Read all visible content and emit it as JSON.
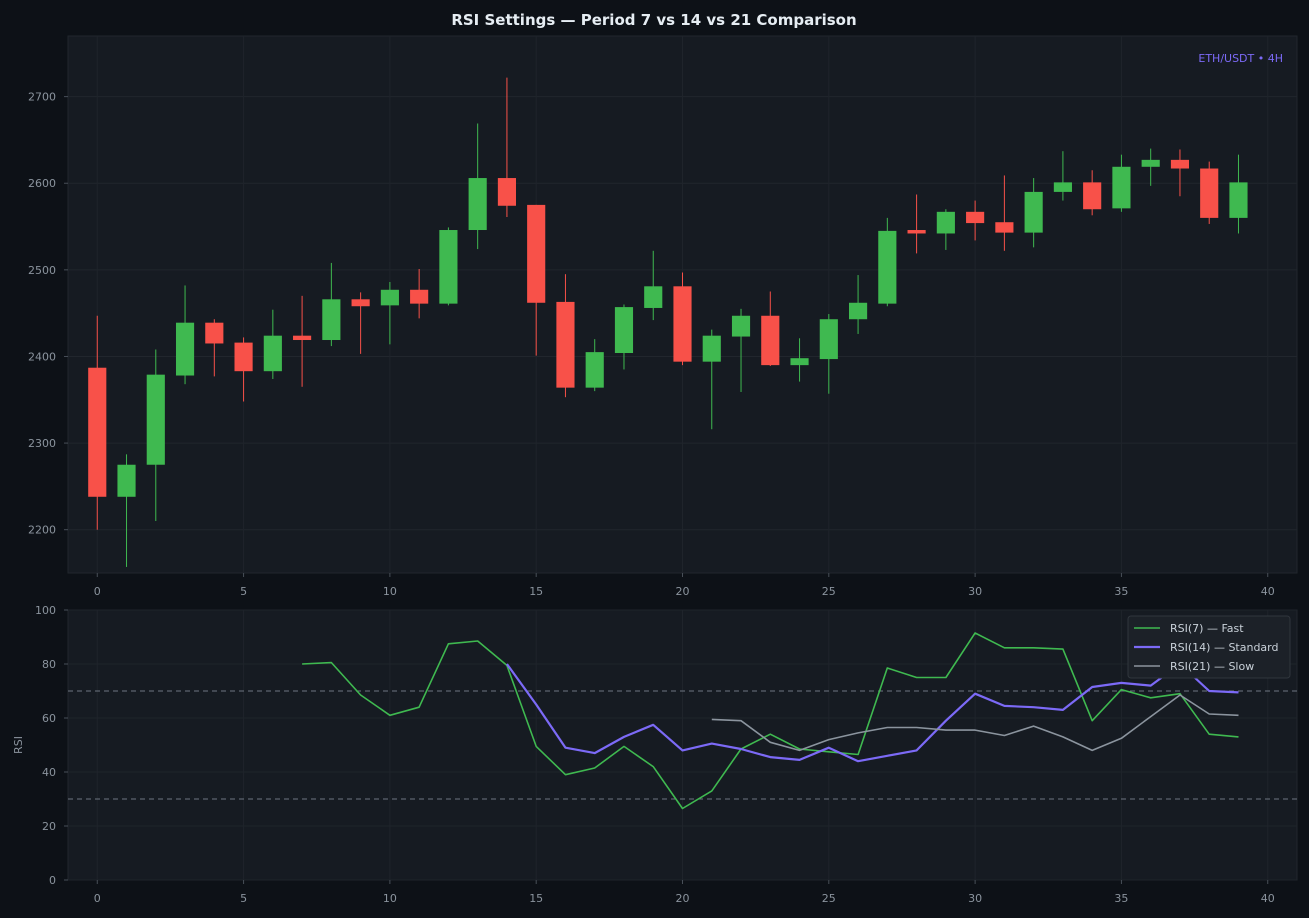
{
  "title": "RSI Settings — Period 7 vs 14 vs 21 Comparison",
  "colors": {
    "background": "#0d1117",
    "panel": "#161b22",
    "up": "#3fb950",
    "down": "#f85149",
    "rsi7": "#3fb950",
    "rsi14": "#7c6af7",
    "rsi21": "#8b949e",
    "tick_text": "#8b949e",
    "title_text": "#e6edf3",
    "watermark": "#7c6af7"
  },
  "chart_data": [
    {
      "type": "candlestick",
      "annotation": "ETH/USDT • 4H",
      "xlim": [
        -1,
        41
      ],
      "ylim": [
        2150,
        2770
      ],
      "xticks": [
        0,
        5,
        10,
        15,
        20,
        25,
        30,
        35,
        40
      ],
      "yticks": [
        2200,
        2300,
        2400,
        2500,
        2600,
        2700
      ],
      "grid": true,
      "candles": [
        {
          "x": 0,
          "o": 2387,
          "h": 2447,
          "l": 2200,
          "c": 2238
        },
        {
          "x": 1,
          "o": 2238,
          "h": 2287,
          "l": 2157,
          "c": 2275
        },
        {
          "x": 2,
          "o": 2275,
          "h": 2408,
          "l": 2210,
          "c": 2379
        },
        {
          "x": 3,
          "o": 2378,
          "h": 2482,
          "l": 2368,
          "c": 2439
        },
        {
          "x": 4,
          "o": 2439,
          "h": 2443,
          "l": 2377,
          "c": 2415
        },
        {
          "x": 5,
          "o": 2416,
          "h": 2422,
          "l": 2348,
          "c": 2383
        },
        {
          "x": 6,
          "o": 2383,
          "h": 2454,
          "l": 2374,
          "c": 2424
        },
        {
          "x": 7,
          "o": 2424,
          "h": 2470,
          "l": 2365,
          "c": 2419
        },
        {
          "x": 8,
          "o": 2419,
          "h": 2508,
          "l": 2412,
          "c": 2466
        },
        {
          "x": 9,
          "o": 2466,
          "h": 2474,
          "l": 2403,
          "c": 2458
        },
        {
          "x": 10,
          "o": 2459,
          "h": 2486,
          "l": 2414,
          "c": 2477
        },
        {
          "x": 11,
          "o": 2477,
          "h": 2501,
          "l": 2444,
          "c": 2461
        },
        {
          "x": 12,
          "o": 2461,
          "h": 2549,
          "l": 2459,
          "c": 2546
        },
        {
          "x": 13,
          "o": 2546,
          "h": 2669,
          "l": 2524,
          "c": 2606
        },
        {
          "x": 14,
          "o": 2606,
          "h": 2722,
          "l": 2561,
          "c": 2574
        },
        {
          "x": 15,
          "o": 2575,
          "h": 2575,
          "l": 2401,
          "c": 2462
        },
        {
          "x": 16,
          "o": 2463,
          "h": 2495,
          "l": 2353,
          "c": 2364
        },
        {
          "x": 17,
          "o": 2364,
          "h": 2420,
          "l": 2360,
          "c": 2405
        },
        {
          "x": 18,
          "o": 2404,
          "h": 2460,
          "l": 2385,
          "c": 2457
        },
        {
          "x": 19,
          "o": 2456,
          "h": 2522,
          "l": 2442,
          "c": 2481
        },
        {
          "x": 20,
          "o": 2481,
          "h": 2497,
          "l": 2390,
          "c": 2394
        },
        {
          "x": 21,
          "o": 2394,
          "h": 2431,
          "l": 2316,
          "c": 2424
        },
        {
          "x": 22,
          "o": 2423,
          "h": 2455,
          "l": 2359,
          "c": 2447
        },
        {
          "x": 23,
          "o": 2447,
          "h": 2475,
          "l": 2389,
          "c": 2390
        },
        {
          "x": 24,
          "o": 2390,
          "h": 2421,
          "l": 2371,
          "c": 2398
        },
        {
          "x": 25,
          "o": 2397,
          "h": 2449,
          "l": 2357,
          "c": 2443
        },
        {
          "x": 26,
          "o": 2443,
          "h": 2494,
          "l": 2426,
          "c": 2462
        },
        {
          "x": 27,
          "o": 2461,
          "h": 2560,
          "l": 2458,
          "c": 2545
        },
        {
          "x": 28,
          "o": 2546,
          "h": 2587,
          "l": 2519,
          "c": 2542
        },
        {
          "x": 29,
          "o": 2542,
          "h": 2570,
          "l": 2523,
          "c": 2567
        },
        {
          "x": 30,
          "o": 2567,
          "h": 2580,
          "l": 2534,
          "c": 2554
        },
        {
          "x": 31,
          "o": 2555,
          "h": 2609,
          "l": 2522,
          "c": 2543
        },
        {
          "x": 32,
          "o": 2543,
          "h": 2606,
          "l": 2526,
          "c": 2590
        },
        {
          "x": 33,
          "o": 2590,
          "h": 2637,
          "l": 2580,
          "c": 2601
        },
        {
          "x": 34,
          "o": 2601,
          "h": 2615,
          "l": 2563,
          "c": 2570
        },
        {
          "x": 35,
          "o": 2571,
          "h": 2633,
          "l": 2567,
          "c": 2619
        },
        {
          "x": 36,
          "o": 2619,
          "h": 2640,
          "l": 2597,
          "c": 2627
        },
        {
          "x": 37,
          "o": 2627,
          "h": 2639,
          "l": 2585,
          "c": 2617
        },
        {
          "x": 38,
          "o": 2617,
          "h": 2625,
          "l": 2553,
          "c": 2560
        },
        {
          "x": 39,
          "o": 2560,
          "h": 2633,
          "l": 2542,
          "c": 2601
        }
      ]
    },
    {
      "type": "line",
      "ylabel": "RSI",
      "xlim": [
        -1,
        41
      ],
      "ylim": [
        0,
        100
      ],
      "xticks": [
        0,
        5,
        10,
        15,
        20,
        25,
        30,
        35,
        40
      ],
      "yticks": [
        0,
        20,
        40,
        60,
        80,
        100
      ],
      "hlines": [
        30,
        70
      ],
      "grid": true,
      "legend": "top-right",
      "series": [
        {
          "name": "RSI(7) — Fast",
          "x": [
            7,
            8,
            9,
            10,
            11,
            12,
            13,
            14,
            15,
            16,
            17,
            18,
            19,
            20,
            21,
            22,
            23,
            24,
            25,
            26,
            27,
            28,
            29,
            30,
            31,
            32,
            33,
            34,
            35,
            36,
            37,
            38,
            39
          ],
          "values": [
            80,
            80.5,
            68.5,
            61,
            64,
            87.5,
            88.5,
            79.5,
            49.5,
            39,
            41.5,
            49.5,
            42,
            26.5,
            33,
            48.5,
            54,
            48.5,
            47.5,
            46.5,
            78.5,
            75,
            75,
            91.5,
            86,
            86,
            85.5,
            59,
            70.5,
            67.5,
            69,
            54,
            53
          ]
        },
        {
          "name": "RSI(14) — Standard",
          "x": [
            14,
            15,
            16,
            17,
            18,
            19,
            20,
            21,
            22,
            23,
            24,
            25,
            26,
            27,
            28,
            29,
            30,
            31,
            32,
            33,
            34,
            35,
            36,
            37,
            38,
            39
          ],
          "values": [
            80,
            65,
            49,
            47,
            53,
            57.5,
            48,
            50.5,
            48.5,
            45.5,
            44.5,
            49,
            44,
            46,
            48,
            59,
            69,
            64.5,
            64,
            63,
            71.5,
            73,
            72,
            80,
            70,
            69.5
          ]
        },
        {
          "name": "RSI(21) — Slow",
          "x": [
            21,
            22,
            23,
            24,
            25,
            26,
            27,
            28,
            29,
            30,
            31,
            32,
            33,
            34,
            35,
            36,
            37,
            38,
            39
          ],
          "values": [
            59.5,
            59,
            51,
            48,
            52,
            54.5,
            56.5,
            56.5,
            55.5,
            55.5,
            53.5,
            57,
            53,
            48,
            52.5,
            60.5,
            68.5,
            61.5,
            61
          ]
        }
      ]
    }
  ]
}
